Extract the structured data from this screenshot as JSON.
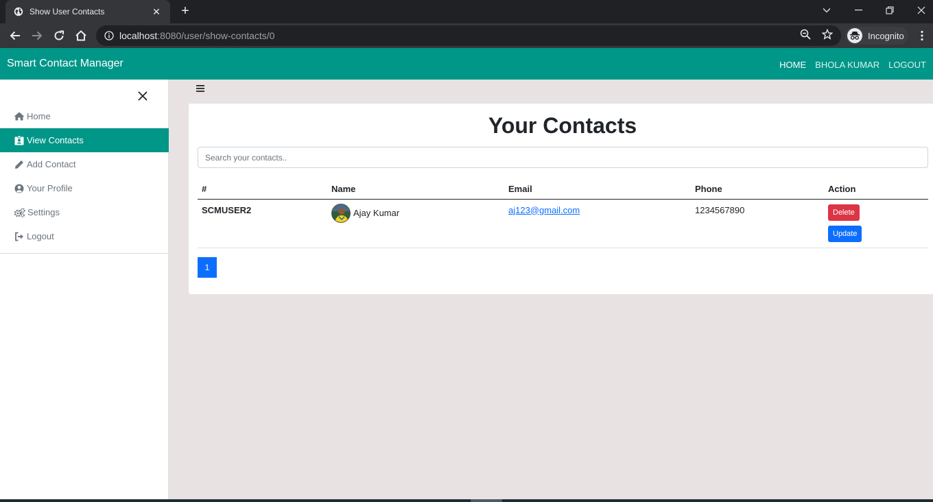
{
  "browser": {
    "tab_title": "Show User Contacts",
    "url_host": "localhost",
    "url_path": ":8080/user/show-contacts/0",
    "profile_label": "Incognito"
  },
  "app": {
    "brand": "Smart Contact Manager",
    "nav": {
      "home": "HOME",
      "user": "BHOLA KUMAR",
      "logout": "LOGOUT"
    },
    "sidebar": {
      "items": [
        {
          "label": "Home",
          "icon": "home-icon"
        },
        {
          "label": "View Contacts",
          "icon": "id-card-icon",
          "active": true
        },
        {
          "label": "Add Contact",
          "icon": "pencil-icon"
        },
        {
          "label": "Your Profile",
          "icon": "user-circle-icon"
        },
        {
          "label": "Settings",
          "icon": "cogs-icon"
        },
        {
          "label": "Logout",
          "icon": "sign-out-icon"
        }
      ]
    },
    "page_title": "Your Contacts",
    "search": {
      "placeholder": "Search your contacts.."
    },
    "table": {
      "headers": [
        "#",
        "Name",
        "Email",
        "Phone",
        "Action"
      ],
      "rows": [
        {
          "id": "SCMUSER2",
          "name": "Ajay Kumar",
          "email": "aj123@gmail.com",
          "phone": "1234567890",
          "delete_label": "Delete",
          "update_label": "Update"
        }
      ]
    },
    "pagination": {
      "current": "1"
    },
    "colors": {
      "primary": "#009688",
      "danger": "#dc3545",
      "link": "#0d6efd"
    }
  }
}
